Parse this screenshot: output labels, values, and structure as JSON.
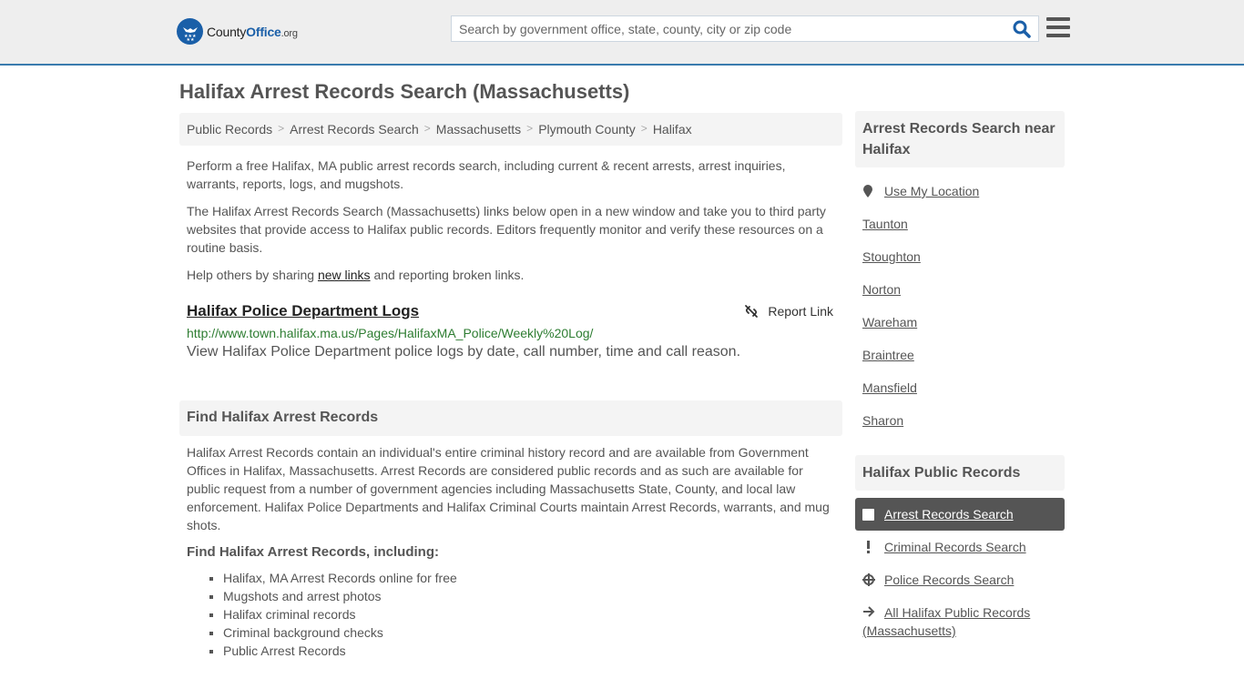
{
  "header": {
    "logo": {
      "name_part1": "County",
      "name_part2": "Office",
      "name_tld": ".org"
    },
    "search": {
      "placeholder": "Search by government office, state, county, city or zip code",
      "value": ""
    },
    "icons": {
      "search": "search-icon",
      "menu": "hamburger-menu-icon"
    }
  },
  "page": {
    "title": "Halifax Arrest Records Search (Massachusetts)"
  },
  "breadcrumb": [
    "Public Records",
    "Arrest Records Search",
    "Massachusetts",
    "Plymouth County",
    "Halifax"
  ],
  "intro": {
    "p1": "Perform a free Halifax, MA public arrest records search, including current & recent arrests, arrest inquiries, warrants, reports, logs, and mugshots.",
    "p2": "The Halifax Arrest Records Search (Massachusetts) links below open in a new window and take you to third party websites that provide access to Halifax public records. Editors frequently monitor and verify these resources on a routine basis.",
    "p3_before": "Help others by sharing ",
    "p3_link": "new links",
    "p3_after": " and reporting broken links."
  },
  "resources": [
    {
      "title": "Halifax Police Department Logs",
      "url": "http://www.town.halifax.ma.us/Pages/HalifaxMA_Police/Weekly%20Log/",
      "description": "View Halifax Police Department police logs by date, call number, time and call reason.",
      "report_label": "Report Link"
    }
  ],
  "find_section": {
    "header": "Find Halifax Arrest Records",
    "body": "Halifax Arrest Records contain an individual's entire criminal history record and are available from Government Offices in Halifax, Massachusetts. Arrest Records are considered public records and as such are available for public request from a number of government agencies including Massachusetts State, County, and local law enforcement. Halifax Police Departments and Halifax Criminal Courts maintain Arrest Records, warrants, and mug shots.",
    "subheader": "Find Halifax Arrest Records, including:",
    "items": [
      "Halifax, MA Arrest Records online for free",
      "Mugshots and arrest photos",
      "Halifax criminal records",
      "Criminal background checks",
      "Public Arrest Records"
    ]
  },
  "sidebar": {
    "nearby": {
      "header": "Arrest Records Search near Halifax",
      "use_location": "Use My Location",
      "cities": [
        "Taunton",
        "Stoughton",
        "Norton",
        "Wareham",
        "Braintree",
        "Mansfield",
        "Sharon"
      ]
    },
    "public_records": {
      "header": "Halifax Public Records",
      "items": [
        {
          "label": "Arrest Records Search",
          "icon": "square-icon",
          "active": true
        },
        {
          "label": "Criminal Records Search",
          "icon": "exclamation-icon",
          "active": false
        },
        {
          "label": "Police Records Search",
          "icon": "crosshair-icon",
          "active": false
        },
        {
          "label": "All Halifax Public Records (Massachusetts)",
          "icon": "arrow-right-icon",
          "active": false
        }
      ]
    }
  }
}
